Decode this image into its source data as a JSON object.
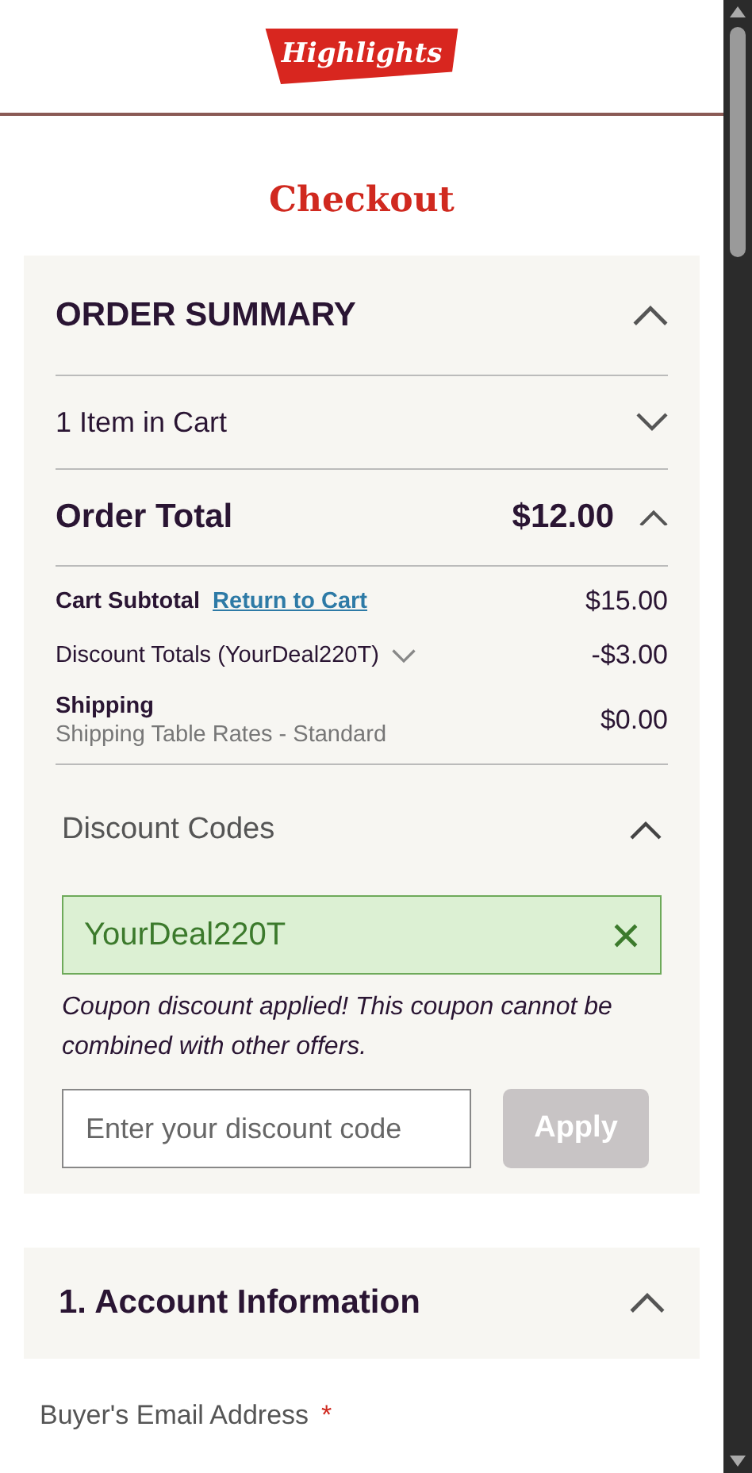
{
  "header": {
    "logo": "Highlights"
  },
  "page_title": "Checkout",
  "order_summary": {
    "title": "ORDER SUMMARY",
    "expanded": true,
    "cart": {
      "label": "1 Item in Cart",
      "expanded": false
    },
    "order_total": {
      "label": "Order Total",
      "amount": "$12.00",
      "expanded": true
    },
    "lines": [
      {
        "kind": "link",
        "label": "Cart Subtotal",
        "link": "Return to Cart",
        "amount": "$15.00"
      },
      {
        "kind": "dropdown",
        "label": "Discount Totals (YourDeal220T)",
        "amount": "-$3.00",
        "expanded": false
      },
      {
        "kind": "detail",
        "label": "Shipping",
        "detail": "Shipping Table Rates - Standard",
        "amount": "$0.00"
      }
    ],
    "discount": {
      "title": "Discount Codes",
      "expanded": true,
      "applied_code": "YourDeal220T",
      "message": "Coupon discount applied! This coupon cannot be combined with other offers.",
      "placeholder": "Enter your discount code",
      "button": {
        "label": "Apply",
        "disabled": true
      }
    }
  },
  "account": {
    "title": "1. Account Information",
    "expanded": true,
    "email_label": "Buyer's Email Address",
    "required_mark": "*"
  }
}
